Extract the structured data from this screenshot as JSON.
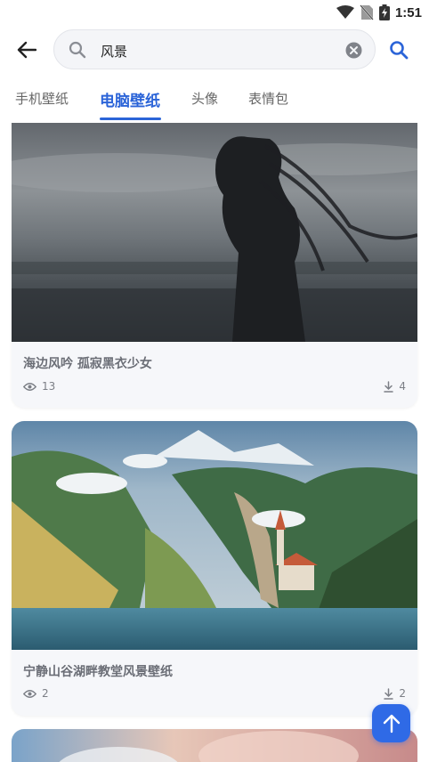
{
  "status_bar": {
    "time": "1:51",
    "icons": [
      "wifi-icon",
      "no-sim-icon",
      "battery-charging-icon"
    ]
  },
  "search": {
    "query": "风景",
    "icons": [
      "back-arrow-icon",
      "search-icon",
      "clear-icon"
    ]
  },
  "tabs": [
    {
      "label": "手机壁纸",
      "active": false
    },
    {
      "label": "电脑壁纸",
      "active": true
    },
    {
      "label": "头像",
      "active": false
    },
    {
      "label": "表情包",
      "active": false
    }
  ],
  "cards": [
    {
      "title": "海边风吟 孤寂黑衣少女",
      "views": "13",
      "downloads": "4"
    },
    {
      "title": "宁静山谷湖畔教堂风景壁纸",
      "views": "2",
      "downloads": "2"
    }
  ],
  "colors": {
    "accent": "#2b64d8",
    "fab": "#2f6ae6",
    "card_bg": "#f6f7fa",
    "muted_text": "#6b6e76"
  },
  "fab": {
    "icon": "arrow-up-icon"
  }
}
